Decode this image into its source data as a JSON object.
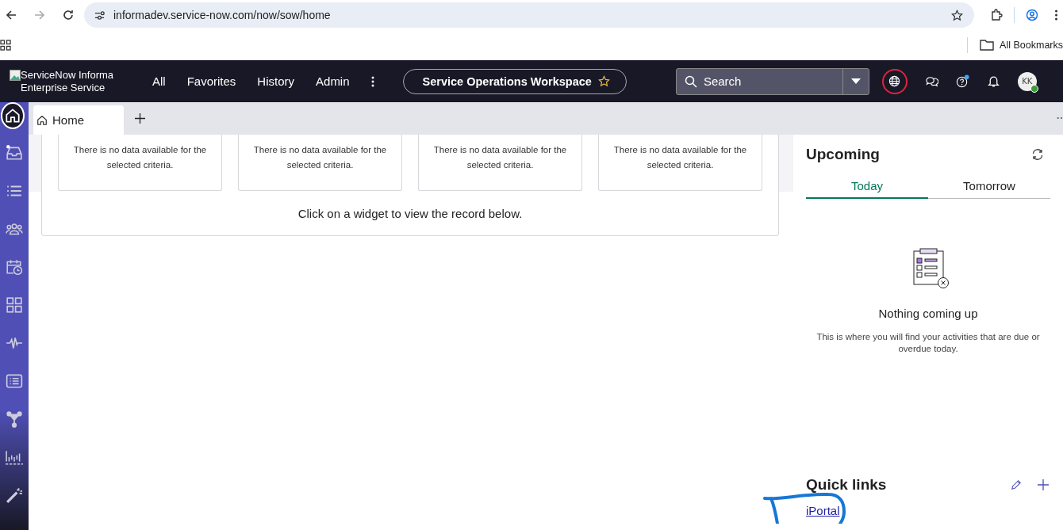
{
  "browser": {
    "url": "informadev.service-now.com/now/sow/home",
    "bookmarks_label": "All Bookmarks"
  },
  "header": {
    "logo_alt": "ServiceNow Informa Enterprise Service",
    "nav": [
      "All",
      "Favorites",
      "History",
      "Admin"
    ],
    "workspace": "Service Operations Workspace",
    "search": {
      "placeholder": "Search"
    },
    "avatar": "KK"
  },
  "sidebar": [
    {
      "kind": "home",
      "selected": true
    },
    {
      "kind": "inbox",
      "selected": false
    },
    {
      "kind": "list",
      "selected": false
    },
    {
      "kind": "people",
      "selected": false
    },
    {
      "kind": "calendar",
      "selected": false
    },
    {
      "kind": "grid",
      "selected": false
    },
    {
      "kind": "pulse",
      "selected": false
    },
    {
      "kind": "card",
      "selected": false
    },
    {
      "kind": "branch",
      "selected": false
    },
    {
      "kind": "bars",
      "selected": false
    },
    {
      "kind": "wand",
      "selected": false
    }
  ],
  "tabs": [
    {
      "label": "Home",
      "selected": true
    }
  ],
  "widgets": [
    {
      "message": "There is no data available for the selected criteria."
    },
    {
      "message": "There is no data available for the selected criteria."
    },
    {
      "message": "There is no data available for the selected criteria."
    },
    {
      "message": "There is no data available for the selected criteria."
    }
  ],
  "widget_hint": "Click on a widget to view the record below.",
  "upcoming": {
    "title": "Upcoming",
    "tabs": [
      {
        "label": "Today",
        "selected": true
      },
      {
        "label": "Tomorrow",
        "selected": false
      }
    ],
    "empty_title": "Nothing coming up",
    "empty_text": "This is where you will find your activities that are due or overdue today."
  },
  "quick_links": {
    "title": "Quick links",
    "links": [
      "iPortal"
    ]
  }
}
